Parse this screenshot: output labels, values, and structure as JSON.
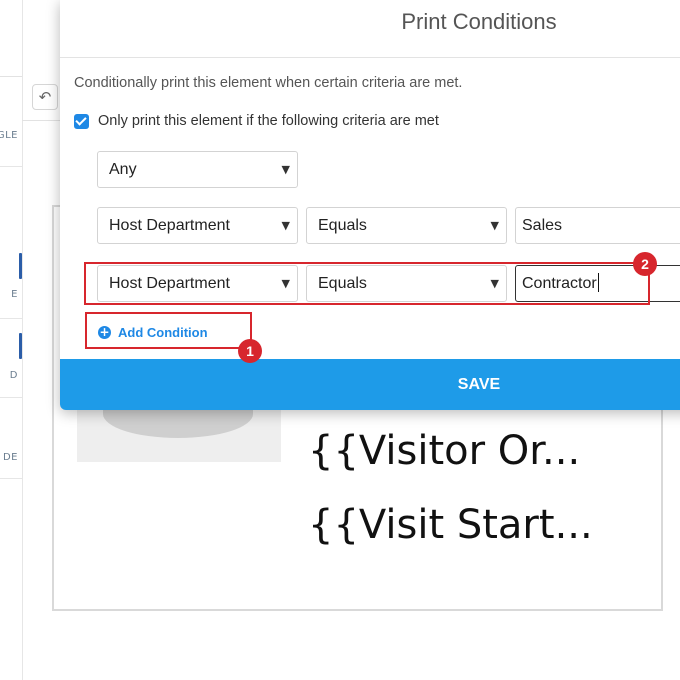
{
  "background": {
    "side_tools": [
      {
        "label": "GLE",
        "icon": "rectangle-tool-icon"
      },
      {
        "label": "E",
        "icon": "image-tool-icon"
      },
      {
        "label": "D",
        "icon": "field-tool-icon"
      },
      {
        "label": "DE",
        "icon": "barcode-tool-icon"
      }
    ],
    "undo_icon": "undo-icon",
    "canvas_lines": [
      "{{Visitor Or...",
      "{{Visit Start..."
    ]
  },
  "modal": {
    "title": "Print Conditions",
    "description": "Conditionally print this element when certain criteria are met.",
    "only_print_label": "Only print this element if the following criteria are met",
    "only_print_checked": true,
    "match_select": "Any",
    "conditions": [
      {
        "field": "Host Department",
        "operator": "Equals",
        "value": "Sales"
      },
      {
        "field": "Host Department",
        "operator": "Equals",
        "value": "Contractor"
      }
    ],
    "add_condition_label": "Add Condition",
    "save_label": "SAVE"
  },
  "annotations": {
    "badge_1": "1",
    "badge_2": "2",
    "color": "#d7262d"
  },
  "colors": {
    "accent": "#1e88e5",
    "save_button": "#1e9be8"
  }
}
